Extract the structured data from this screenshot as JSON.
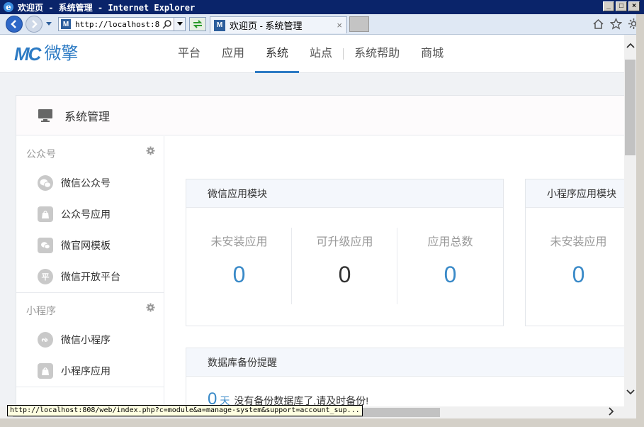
{
  "window": {
    "title": "欢迎页 - 系统管理 - Internet Explorer",
    "controls": {
      "minimize": "_",
      "maximize": "□",
      "close": "×"
    }
  },
  "browser": {
    "address_url": "http://localhost:808",
    "tab_title": "欢迎页 - 系统管理",
    "tab_close": "×",
    "status_url": "http://localhost:808/web/index.php?c=module&a=manage-system&support=account_sup..."
  },
  "header": {
    "logo_mark": "MC",
    "logo_text": "微擎",
    "nav": [
      {
        "label": "平台"
      },
      {
        "label": "应用"
      },
      {
        "label": "系统",
        "active": true
      },
      {
        "label": "站点"
      },
      {
        "label": "系统帮助"
      },
      {
        "label": "商城"
      }
    ]
  },
  "panel": {
    "title": "系统管理"
  },
  "sidebar": {
    "groups": [
      {
        "label": "公众号",
        "items": [
          {
            "label": "微信公众号",
            "icon": "wechat-icon"
          },
          {
            "label": "公众号应用",
            "icon": "bag-icon"
          },
          {
            "label": "微官网模板",
            "icon": "template-icon"
          },
          {
            "label": "微信开放平台",
            "icon": "platform-icon",
            "glyph": "平"
          }
        ]
      },
      {
        "label": "小程序",
        "items": [
          {
            "label": "微信小程序",
            "icon": "miniprogram-icon"
          },
          {
            "label": "小程序应用",
            "icon": "bag-icon"
          }
        ]
      }
    ]
  },
  "wechat_card": {
    "title": "微信应用模块",
    "stats": [
      {
        "label": "未安装应用",
        "value": "0"
      },
      {
        "label": "可升级应用",
        "value": "0"
      },
      {
        "label": "应用总数",
        "value": "0"
      }
    ]
  },
  "miniprogram_card": {
    "title": "小程序应用模块",
    "stats": [
      {
        "label": "未安装应用",
        "value": "0"
      }
    ]
  },
  "backup_card": {
    "title": "数据库备份提醒",
    "days": "0",
    "days_unit": "天",
    "message": "没有备份数据库了,请及时备份!"
  },
  "colors": {
    "accent": "#2d7bc4",
    "value_blue": "#3a8ac8",
    "titlebar": "#0a246a"
  }
}
